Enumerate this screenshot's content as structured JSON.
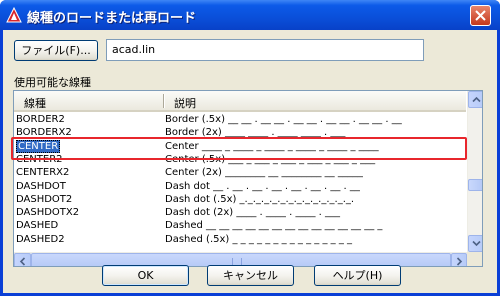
{
  "window": {
    "title": "線種のロードまたは再ロード"
  },
  "file": {
    "button_label": "ファイル(F)...",
    "path_value": "acad.lin"
  },
  "list": {
    "group_label": "使用可能な線種",
    "columns": [
      "線種",
      "説明"
    ],
    "rows": [
      {
        "name": "BORDER2",
        "description": "Border (.5x) __ __ . __ __ . __ __ . __ __ . __ __ . __"
      },
      {
        "name": "BORDERX2",
        "description": "Border (2x) ____ ____ . ____ ____ . ___"
      },
      {
        "name": "CENTER",
        "description": "Center ____ _ ____ _ ____ _ ____ _ ____ _ ____"
      },
      {
        "name": "CENTER2",
        "description": "Center (.5x) ___ _ ___ _ ___ _ ___ _ ___ _ ___"
      },
      {
        "name": "CENTERX2",
        "description": "Center (2x) ________ __ ________ __ _____"
      },
      {
        "name": "DASHDOT",
        "description": "Dash dot __ . __ . __ . __ . __ . __ . __ . __"
      },
      {
        "name": "DASHDOT2",
        "description": "Dash dot (.5x) _._._._._._._._._._._._._._."
      },
      {
        "name": "DASHDOTX2",
        "description": "Dash dot (2x) ____ . ____ . ____ . ___"
      },
      {
        "name": "DASHED",
        "description": "Dashed __ __ __ __ __ __ __ __ __ __ __ __ __ _"
      },
      {
        "name": "DASHED2",
        "description": "Dashed (.5x) _ _ _ _ _ _ _ _ _ _ _ _ _ _ _"
      }
    ],
    "selected_index": 2
  },
  "buttons": {
    "ok": "OK",
    "cancel": "キャンセル",
    "help": "ヘルプ(H)"
  }
}
